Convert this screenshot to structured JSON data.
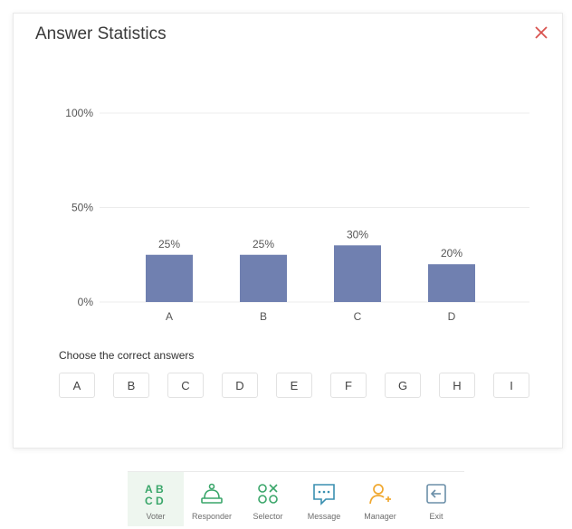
{
  "dialog": {
    "title": "Answer Statistics",
    "close_label": "×"
  },
  "chart_data": {
    "type": "bar",
    "categories": [
      "A",
      "B",
      "C",
      "D"
    ],
    "values": [
      25,
      25,
      30,
      20
    ],
    "value_labels": [
      "25%",
      "25%",
      "30%",
      "20%"
    ],
    "y_ticks": [
      "100%",
      "50%",
      "0%"
    ],
    "ylim": [
      0,
      100
    ],
    "bar_color": "#7080b0",
    "grid": true
  },
  "answers": {
    "label": "Choose the correct answers",
    "options": [
      "A",
      "B",
      "C",
      "D",
      "E",
      "F",
      "G",
      "H",
      "I"
    ]
  },
  "toolbar": {
    "items": [
      {
        "label": "Voter",
        "icon": "voter-icon",
        "active": true
      },
      {
        "label": "Responder",
        "icon": "responder-icon",
        "active": false
      },
      {
        "label": "Selector",
        "icon": "selector-icon",
        "active": false
      },
      {
        "label": "Message",
        "icon": "message-icon",
        "active": false
      },
      {
        "label": "Manager",
        "icon": "manager-icon",
        "active": false
      },
      {
        "label": "Exit",
        "icon": "exit-icon",
        "active": false
      }
    ]
  },
  "colors": {
    "accent_green": "#3aa66a",
    "close_red": "#d9534f",
    "manager_orange": "#f0a830",
    "bar": "#7080b0"
  }
}
